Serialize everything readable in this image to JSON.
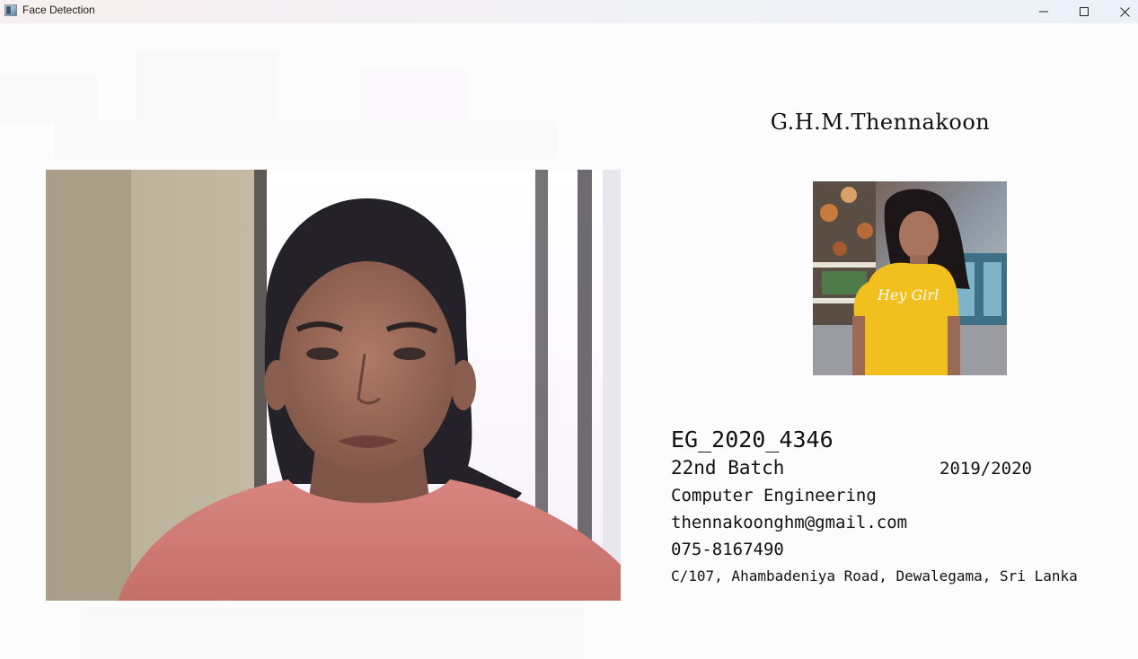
{
  "window": {
    "title": "Face Detection",
    "icon": "app-window-icon",
    "controls": [
      "minimize-icon",
      "maximize-icon",
      "close-icon"
    ]
  },
  "camera": {
    "description_icon": "webcam-feed"
  },
  "profile": {
    "name": "G.H.M.Thennakoon",
    "photo_icon": "profile-photo",
    "registration_no": "EG_2020_4346",
    "batch": "22nd Batch",
    "academic_year": "2019/2020",
    "department": "Computer Engineering",
    "email": "thennakoonghm@gmail.com",
    "phone": "075-8167490",
    "address": "C/107, Ahambadeniya Road, Dewalegama, Sri Lanka"
  },
  "colors": {
    "text": "#111111",
    "titlebar": "#f2f3f7",
    "background": "#fdfcfd"
  }
}
